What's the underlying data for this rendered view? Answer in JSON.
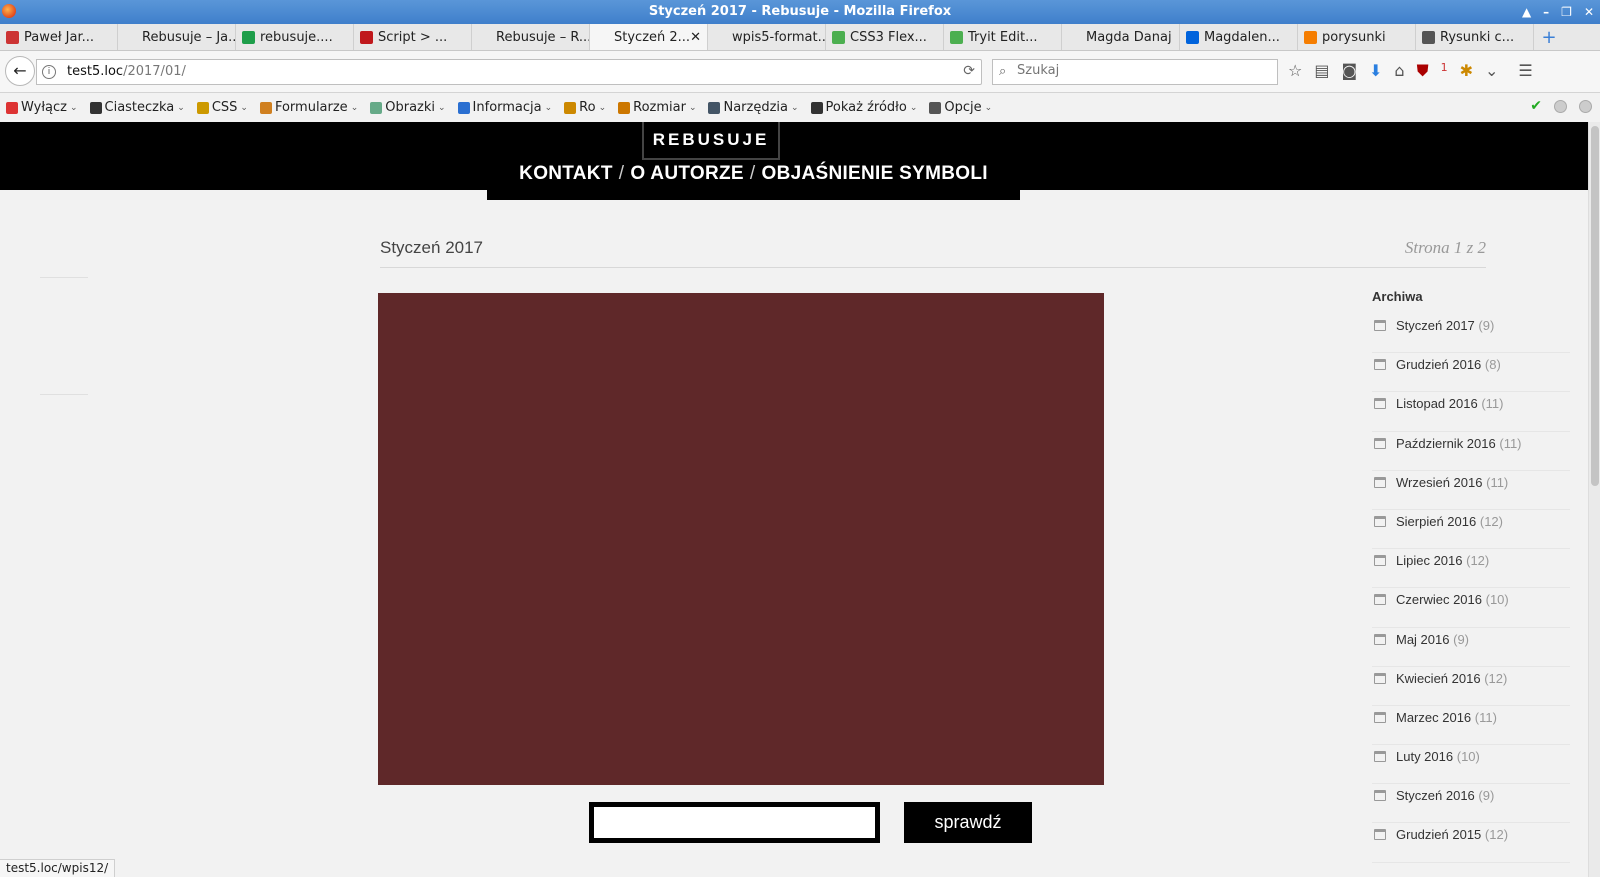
{
  "window": {
    "title": "Styczeń 2017 - Rebusuje - Mozilla Firefox"
  },
  "tabs": [
    {
      "label": "Paweł Jar...",
      "icon": "avatar-icon",
      "color": "#c33"
    },
    {
      "label": "Rebusuje – Ja...",
      "icon": "",
      "color": ""
    },
    {
      "label": "rebusuje....",
      "icon": "sheet-icon",
      "color": "#1e9e4a"
    },
    {
      "label": "Script > ...",
      "icon": "script-icon",
      "color": "#c0181c"
    },
    {
      "label": "Rebusuje – R...",
      "icon": "",
      "color": ""
    },
    {
      "label": "Styczeń 2...",
      "icon": "",
      "color": "",
      "active": true
    },
    {
      "label": "wpis5-format...",
      "icon": "",
      "color": ""
    },
    {
      "label": "CSS3 Flex...",
      "icon": "w3-icon",
      "color": "#4caf50"
    },
    {
      "label": "Tryit Edit...",
      "icon": "w3-icon",
      "color": "#4caf50"
    },
    {
      "label": "Magda Danaj",
      "icon": "",
      "color": ""
    },
    {
      "label": "Magdalen...",
      "icon": "flickr-icon",
      "color": "#0063dc"
    },
    {
      "label": "porysunki",
      "icon": "blogger-icon",
      "color": "#f57d00"
    },
    {
      "label": "Rysunki c...",
      "icon": "web-icon",
      "color": "#555"
    }
  ],
  "nav": {
    "url_host": "test5.loc",
    "url_path": "/2017/01/",
    "search_placeholder": "Szukaj",
    "badge_count": "1"
  },
  "devbar": [
    {
      "label": "Wyłącz",
      "icon": "disable-icon",
      "color": "#d33"
    },
    {
      "label": "Ciasteczka",
      "icon": "cookie-icon",
      "color": "#333"
    },
    {
      "label": "CSS",
      "icon": "css-icon",
      "color": "#c90"
    },
    {
      "label": "Formularze",
      "icon": "forms-icon",
      "color": "#d08020"
    },
    {
      "label": "Obrazki",
      "icon": "images-icon",
      "color": "#6a8"
    },
    {
      "label": "Informacja",
      "icon": "info-icon",
      "color": "#2a6fd1"
    },
    {
      "label": "Ro",
      "icon": "misc-icon",
      "color": "#c80"
    },
    {
      "label": "Rozmiar",
      "icon": "resize-icon",
      "color": "#c70"
    },
    {
      "label": "Narzędzia",
      "icon": "tools-icon",
      "color": "#456"
    },
    {
      "label": "Pokaż źródło",
      "icon": "source-icon",
      "color": "#333"
    },
    {
      "label": "Opcje",
      "icon": "options-icon",
      "color": "#555"
    }
  ],
  "site": {
    "logo": "REBUSUJE",
    "menu": [
      "KONTAKT",
      "O AUTORZE",
      "OBJAŚNIENIE SYMBOLI"
    ],
    "menu_separator": "/"
  },
  "archive": {
    "title": "Styczeń 2017",
    "page_info": "Strona 1 z 2"
  },
  "rebus": {
    "color": "#5f2829"
  },
  "answer_form": {
    "input_value": "",
    "button": "sprawdź"
  },
  "sidebar": {
    "heading": "Archiwa",
    "items": [
      {
        "label": "Styczeń 2017",
        "count": "(9)"
      },
      {
        "label": "Grudzień 2016",
        "count": "(8)"
      },
      {
        "label": "Listopad 2016",
        "count": "(11)"
      },
      {
        "label": "Październik 2016",
        "count": "(11)"
      },
      {
        "label": "Wrzesień 2016",
        "count": "(11)"
      },
      {
        "label": "Sierpień 2016",
        "count": "(12)"
      },
      {
        "label": "Lipiec 2016",
        "count": "(12)"
      },
      {
        "label": "Czerwiec 2016",
        "count": "(10)"
      },
      {
        "label": "Maj 2016",
        "count": "(9)"
      },
      {
        "label": "Kwiecień 2016",
        "count": "(12)"
      },
      {
        "label": "Marzec 2016",
        "count": "(11)"
      },
      {
        "label": "Luty 2016",
        "count": "(10)"
      },
      {
        "label": "Styczeń 2016",
        "count": "(9)"
      },
      {
        "label": "Grudzień 2015",
        "count": "(12)"
      }
    ]
  },
  "status_bar": "test5.loc/wpis12/"
}
